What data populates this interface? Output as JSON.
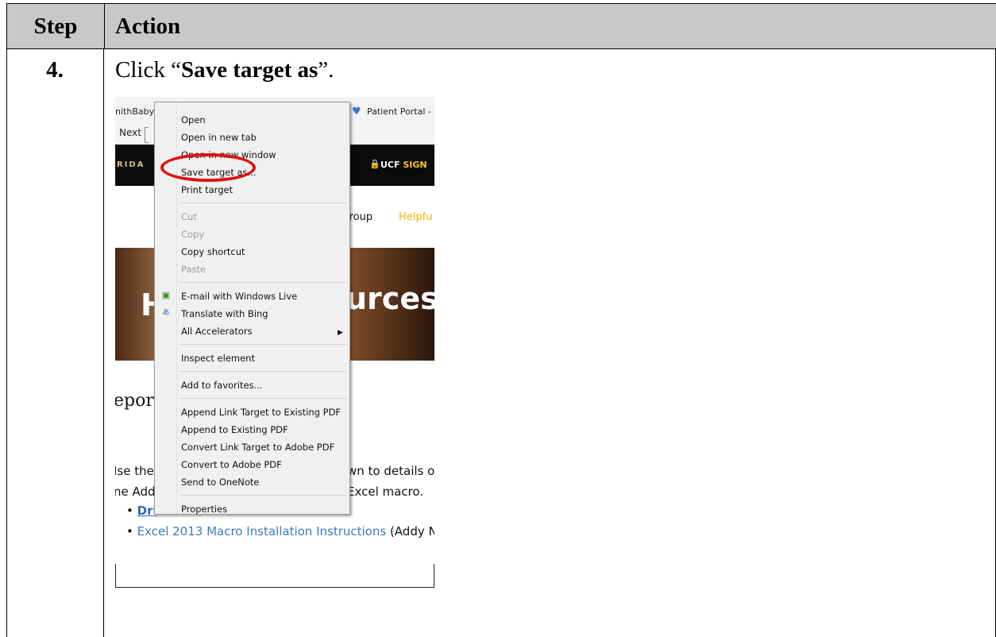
{
  "table": {
    "header_step": "Step",
    "header_action": "Action"
  },
  "step": {
    "number": "4.",
    "instruction_prefix": "Click “",
    "instruction_bold": "Save target as",
    "instruction_suffix": "”."
  },
  "screenshot": {
    "tab_left": "nithBaby",
    "tab_right": "Patient Portal - a",
    "find_next": "Next",
    "florida": "RIDA",
    "ucf_prefix": "UCF ",
    "ucf_sign": "SIGN",
    "nav_group": "iroup",
    "nav_helpful": "Helpfu",
    "banner_h": "H",
    "banner_rces": "urces",
    "heading": "epor",
    "body_l1": "Ise the",
    "body_r1": "wn to details o",
    "body_l2": "ne Add",
    "body_r2": "Excel macro.",
    "bullet1_link": "Dri",
    "bullet2_link": "Excel 2013 Macro Installation Instructions",
    "bullet2_rest": " (Addy Nc",
    "context_menu": {
      "items": [
        {
          "label": "Open",
          "enabled": true
        },
        {
          "label": "Open in new tab",
          "enabled": true
        },
        {
          "label": "Open in new window",
          "enabled": true
        },
        {
          "label": "Save target as...",
          "enabled": true
        },
        {
          "label": "Print target",
          "enabled": true
        },
        {
          "label": "Cut",
          "enabled": false
        },
        {
          "label": "Copy",
          "enabled": false
        },
        {
          "label": "Copy shortcut",
          "enabled": true
        },
        {
          "label": "Paste",
          "enabled": false
        },
        {
          "label": "E-mail with Windows Live",
          "enabled": true,
          "icon": "windows-live-icon"
        },
        {
          "label": "Translate with Bing",
          "enabled": true,
          "icon": "translate-icon"
        },
        {
          "label": "All Accelerators",
          "enabled": true,
          "submenu": true
        },
        {
          "label": "Inspect element",
          "enabled": true
        },
        {
          "label": "Add to favorites...",
          "enabled": true
        },
        {
          "label": "Append Link Target to Existing PDF",
          "enabled": true
        },
        {
          "label": "Append to Existing PDF",
          "enabled": true
        },
        {
          "label": "Convert Link Target to Adobe PDF",
          "enabled": true
        },
        {
          "label": "Convert to Adobe PDF",
          "enabled": true
        },
        {
          "label": "Send to OneNote",
          "enabled": true
        },
        {
          "label": "Properties",
          "enabled": true
        }
      ]
    },
    "highlight_color": "#e01010"
  }
}
